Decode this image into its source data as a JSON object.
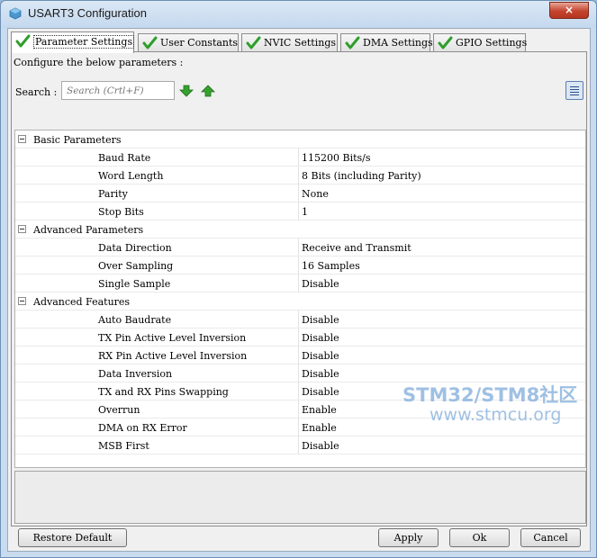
{
  "window": {
    "title": "USART3 Configuration",
    "close_label": "×"
  },
  "tabs": [
    {
      "label": "Parameter Settings",
      "active": true
    },
    {
      "label": "User Constants",
      "active": false
    },
    {
      "label": "NVIC Settings",
      "active": false
    },
    {
      "label": "DMA Settings",
      "active": false
    },
    {
      "label": "GPIO Settings",
      "active": false
    }
  ],
  "panel": {
    "configure_label": "Configure the below parameters :",
    "search_label": "Search :",
    "search_placeholder": "Search (Crtl+F)"
  },
  "groups": [
    {
      "title": "Basic Parameters",
      "rows": [
        {
          "name": "Baud Rate",
          "value": "115200 Bits/s"
        },
        {
          "name": "Word Length",
          "value": "8 Bits (including Parity)"
        },
        {
          "name": "Parity",
          "value": "None"
        },
        {
          "name": "Stop Bits",
          "value": "1"
        }
      ]
    },
    {
      "title": "Advanced Parameters",
      "rows": [
        {
          "name": "Data Direction",
          "value": "Receive and Transmit"
        },
        {
          "name": "Over Sampling",
          "value": "16 Samples"
        },
        {
          "name": "Single Sample",
          "value": "Disable"
        }
      ]
    },
    {
      "title": "Advanced Features",
      "rows": [
        {
          "name": "Auto Baudrate",
          "value": "Disable"
        },
        {
          "name": "TX Pin Active Level Inversion",
          "value": "Disable"
        },
        {
          "name": "RX Pin Active Level Inversion",
          "value": "Disable"
        },
        {
          "name": "Data Inversion",
          "value": "Disable"
        },
        {
          "name": "TX and RX Pins Swapping",
          "value": "Disable"
        },
        {
          "name": "Overrun",
          "value": "Enable"
        },
        {
          "name": "DMA on RX Error",
          "value": "Enable"
        },
        {
          "name": "MSB First",
          "value": "Disable"
        }
      ]
    }
  ],
  "buttons": {
    "restore_default": "Restore Default",
    "apply": "Apply",
    "ok": "Ok",
    "cancel": "Cancel"
  },
  "watermark": {
    "brand": "STM32/STM8社区",
    "url": "www.stmcu.org"
  },
  "colors": {
    "check_green": "#2e9e2a",
    "arrow_green": "#37a12f",
    "title_bar": "#c4d8ee",
    "close_red": "#c4442e"
  }
}
